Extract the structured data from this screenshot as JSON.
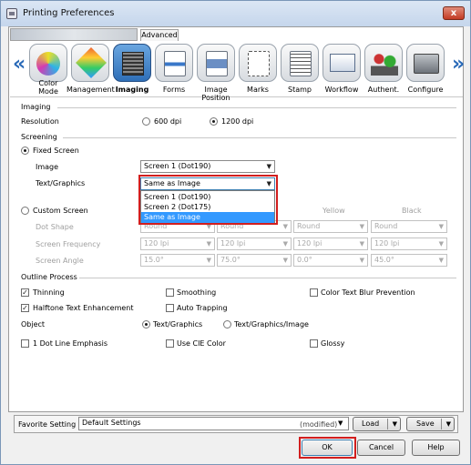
{
  "window": {
    "title": "Printing Preferences",
    "close_symbol": "x"
  },
  "tabs": {
    "printer_tab_label": "",
    "advanced_label": "Advanced"
  },
  "ribbon": {
    "prev_symbol": "«",
    "next_symbol": "»",
    "items": [
      {
        "label": "Color Mode",
        "icon": "color-mode-icon"
      },
      {
        "label": "Management",
        "icon": "management-icon"
      },
      {
        "label": "Imaging",
        "icon": "imaging-icon",
        "selected": true
      },
      {
        "label": "Forms",
        "icon": "forms-icon"
      },
      {
        "label": "Image Position",
        "icon": "image-position-icon"
      },
      {
        "label": "Marks",
        "icon": "marks-icon"
      },
      {
        "label": "Stamp",
        "icon": "stamp-icon"
      },
      {
        "label": "Workflow",
        "icon": "workflow-icon"
      },
      {
        "label": "Authent.",
        "icon": "authentication-icon"
      },
      {
        "label": "Configure",
        "icon": "configure-icon"
      }
    ]
  },
  "imaging": {
    "section_label": "Imaging",
    "resolution_label": "Resolution",
    "res_600": "600 dpi",
    "res_1200": "1200 dpi",
    "selected_resolution": "1200 dpi"
  },
  "screening": {
    "section_label": "Screening",
    "fixed_screen_label": "Fixed Screen",
    "image_label": "Image",
    "image_value": "Screen 1 (Dot190)",
    "text_graphics_label": "Text/Graphics",
    "text_graphics_value": "Same as Image",
    "dropdown_options": [
      "Screen 1 (Dot190)",
      "Screen 2 (Dot175)",
      "Same as Image"
    ],
    "dropdown_highlighted": "Same as Image",
    "custom_screen_label": "Custom Screen",
    "yellow_header": "Yellow",
    "black_header": "Black",
    "dot_shape_label": "Dot Shape",
    "screen_frequency_label": "Screen Frequency",
    "screen_angle_label": "Screen Angle",
    "dot_shape_values": [
      "Round",
      "Round",
      "Round",
      "Round"
    ],
    "frequency_values": [
      "120 lpi",
      "120 lpi",
      "120 lpi",
      "120 lpi"
    ],
    "angle_values": [
      "15.0°",
      "75.0°",
      "0.0°",
      "45.0°"
    ]
  },
  "outline": {
    "section_label": "Outline Process",
    "thinning": "Thinning",
    "smoothing": "Smoothing",
    "color_text_blur": "Color Text Blur Prevention",
    "halftone_text": "Halftone Text Enhancement",
    "auto_trapping": "Auto Trapping",
    "object_label": "Object",
    "object_text_graphics": "Text/Graphics",
    "object_text_graphics_image": "Text/Graphics/Image",
    "dot_line_emphasis": "1 Dot Line Emphasis",
    "use_cie_color": "Use CIE Color",
    "glossy": "Glossy",
    "thinning_checked": true,
    "halftone_checked": true,
    "check_mark": "✓"
  },
  "favorite": {
    "label": "Favorite Setting",
    "value": "Default Settings",
    "status": "(modified)",
    "load_label": "Load",
    "save_label": "Save"
  },
  "footer": {
    "ok_label": "OK",
    "cancel_label": "Cancel",
    "help_label": "Help"
  },
  "colors": {
    "highlight": "#3399ff",
    "accent": "#2f6fb8",
    "callout": "#d21e1e"
  }
}
